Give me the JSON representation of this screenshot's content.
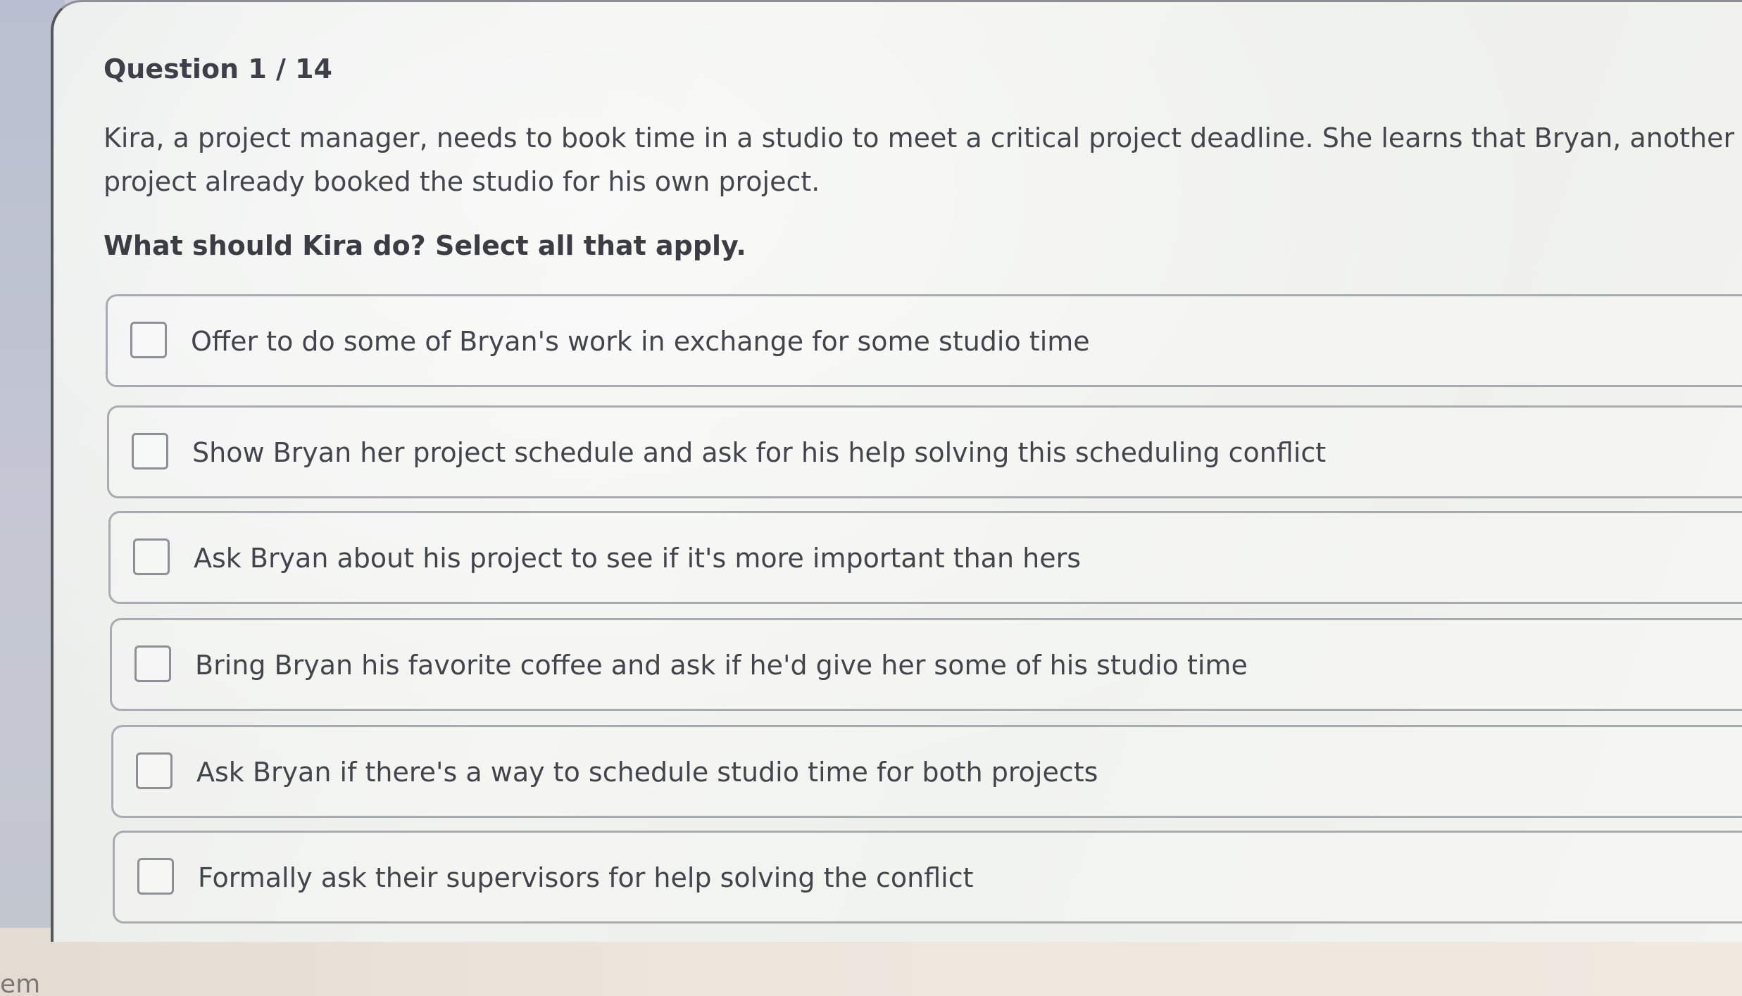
{
  "question": {
    "number_label": "Question 1 / 14",
    "prompt": "Kira, a project manager, needs to book time in a studio to meet a critical project deadline. She learns that Bryan, another project already booked the studio for his own project.",
    "instruction": "What should Kira do? Select all that apply."
  },
  "options": [
    {
      "label": "Offer to do some of Bryan's work in exchange for some studio time",
      "checked": false
    },
    {
      "label": "Show Bryan her project schedule and ask for his help solving this scheduling conflict",
      "checked": false
    },
    {
      "label": "Ask Bryan about his project to see if it's more important than hers",
      "checked": false
    },
    {
      "label": "Bring Bryan his favorite coffee and ask if he'd give her some of his studio time",
      "checked": false
    },
    {
      "label": "Ask Bryan if there's a way to schedule studio time for both projects",
      "checked": false
    },
    {
      "label": "Formally ask their supervisors for help solving the conflict",
      "checked": false
    }
  ],
  "corner_text": "em",
  "colors": {
    "text": "#43454c",
    "border": "#a8abaf",
    "panel": "#eef0ec"
  }
}
